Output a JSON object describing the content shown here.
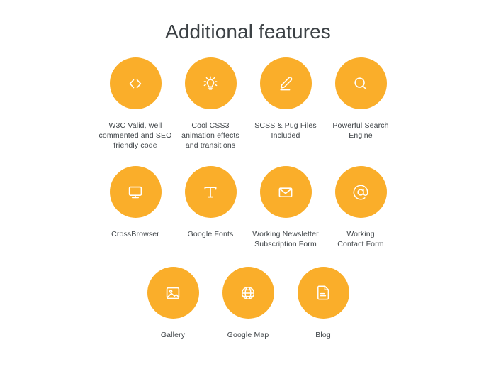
{
  "page": {
    "title": "Additional features",
    "background_color": "#ffffff",
    "accent_color": "#faae2a",
    "text_color": "#3f4448",
    "icon_color": "#ffffff"
  },
  "rows": [
    {
      "items": [
        {
          "icon": "code-icon",
          "label": "W3C Valid, well\ncommented and SEO\nfriendly code"
        },
        {
          "icon": "lightbulb-icon",
          "label": "Cool CSS3\nanimation effects\nand transitions"
        },
        {
          "icon": "pencil-icon",
          "label": "SCSS & Pug Files\nIncluded"
        },
        {
          "icon": "search-icon",
          "label": "Powerful Search\nEngine"
        }
      ]
    },
    {
      "items": [
        {
          "icon": "monitor-icon",
          "label": "CrossBrowser"
        },
        {
          "icon": "text-t-icon",
          "label": "Google Fonts"
        },
        {
          "icon": "envelope-icon",
          "label": "Working Newsletter\nSubscription Form"
        },
        {
          "icon": "at-sign-icon",
          "label": "Working\nContact Form"
        }
      ]
    },
    {
      "items": [
        {
          "icon": "image-icon",
          "label": "Gallery"
        },
        {
          "icon": "globe-icon",
          "label": "Google Map"
        },
        {
          "icon": "document-icon",
          "label": "Blog"
        }
      ]
    }
  ]
}
